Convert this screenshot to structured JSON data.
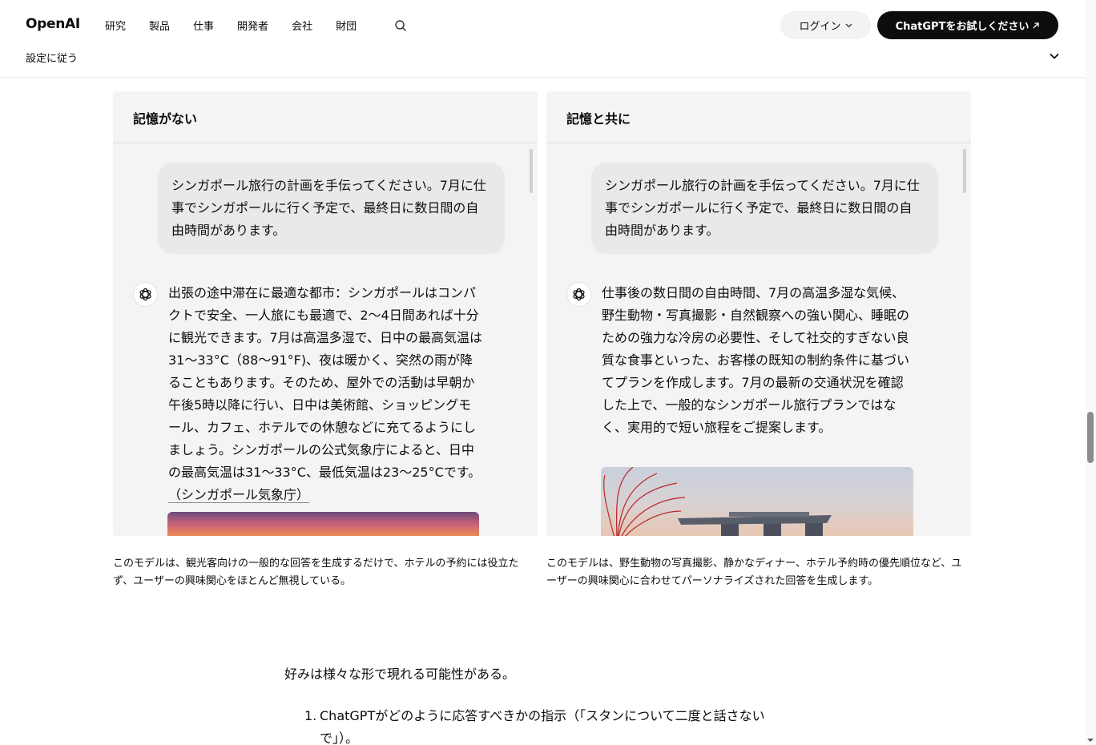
{
  "header": {
    "logo": "OpenAI",
    "nav": [
      "研究",
      "製品",
      "仕事",
      "開発者",
      "会社",
      "財団"
    ],
    "search_icon": "search-icon",
    "login_label": "ログイン",
    "try_label": "ChatGPTをお試しください",
    "subnav_label": "設定に従う"
  },
  "panels": {
    "left": {
      "title": "記憶がない",
      "user_message": "シンガポール旅行の計画を手伝ってください。7月に仕事でシンガポールに行く予定で、最終日に数日間の自由時間があります。",
      "assistant_text": "出張の途中滞在に最適な都市：シンガポールはコンパクトで安全、一人旅にも最適で、2〜4日間あれば十分に観光できます。7月は高温多湿で、日中の最高気温は31〜33°C（88〜91°F)、夜は暖かく、突然の雨が降ることもあります。そのため、屋外での活動は早朝か午後5時以降に行い、日中は美術館、ショッピングモール、カフェ、ホテルでの休憩などに充てるようにしましょう。シンガポールの公式気象庁によると、日中の最高気温は31〜33°C、最低気温は23〜25°Cです。",
      "citation": "（シンガポール気象庁）",
      "caption": "このモデルは、観光客向けの一般的な回答を生成するだけで、ホテルの予約には役立たず、ユーザーの興味関心をほとんど無視している。"
    },
    "right": {
      "title": "記憶と共に",
      "user_message": "シンガポール旅行の計画を手伝ってください。7月に仕事でシンガポールに行く予定で、最終日に数日間の自由時間があります。",
      "assistant_text": "仕事後の数日間の自由時間、7月の高温多湿な気候、野生動物・写真撮影・自然観察への強い関心、睡眠のための強力な冷房の必要性、そして社交的すぎない良質な食事といった、お客様の既知の制約条件に基づいてプランを作成します。7月の最新の交通状況を確認した上で、一般的なシンガポール旅行プランではなく、実用的で短い旅程をご提案します。",
      "caption": "このモデルは、野生動物の写真撮影、静かなディナー、ホテル予約時の優先順位など、ユーザーの興味関心に合わせてパーソナライズされた回答を生成します。"
    }
  },
  "article": {
    "paragraph": "好みは様々な形で現れる可能性がある。",
    "list": [
      {
        "num": "1.",
        "text": "ChatGPTがどのように応答すべきかの指示（「スタンについて二度と話さないで」）。"
      }
    ]
  }
}
